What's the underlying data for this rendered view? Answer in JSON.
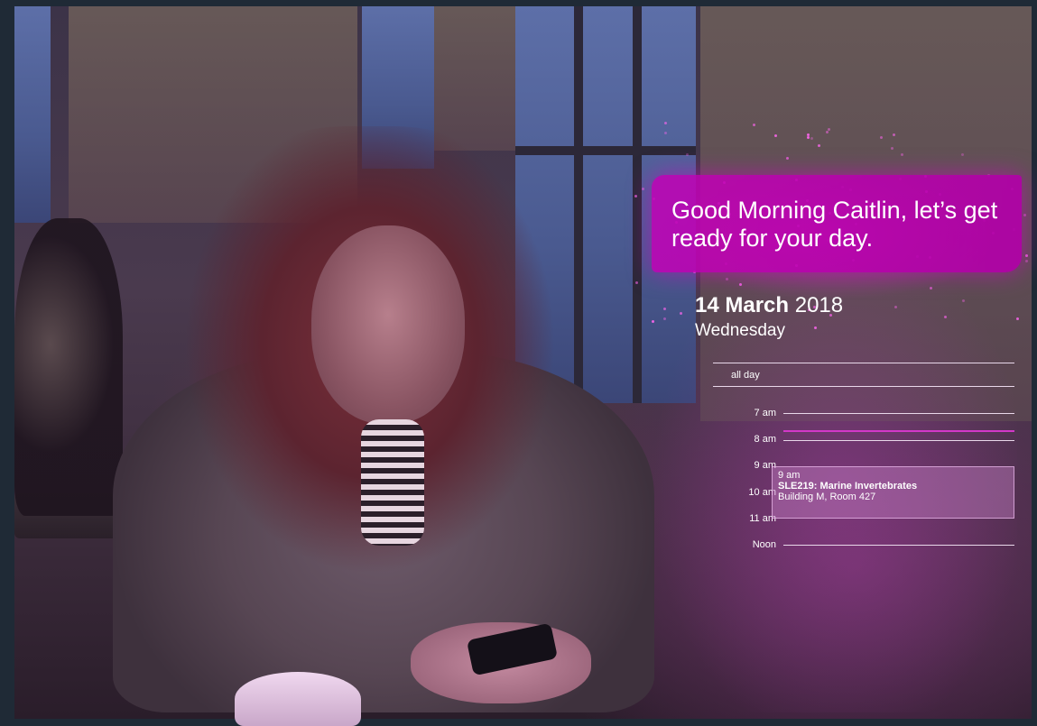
{
  "greeting": "Good Morning Caitlin, let’s get ready for your day.",
  "date": {
    "day_month": "14 March",
    "year": "2018",
    "weekday": "Wednesday"
  },
  "calendar": {
    "all_day_label": "all day",
    "time_labels": [
      "7 am",
      "8 am",
      "9 am",
      "10 am",
      "11 am",
      "Noon"
    ],
    "current_time_color": "#d238c8",
    "event": {
      "start": "9 am",
      "title": "SLE219: Marine Invertebrates",
      "location": "Building M, Room 427"
    }
  },
  "colors": {
    "accent": "#c400b8",
    "background": "#1f2a36"
  }
}
